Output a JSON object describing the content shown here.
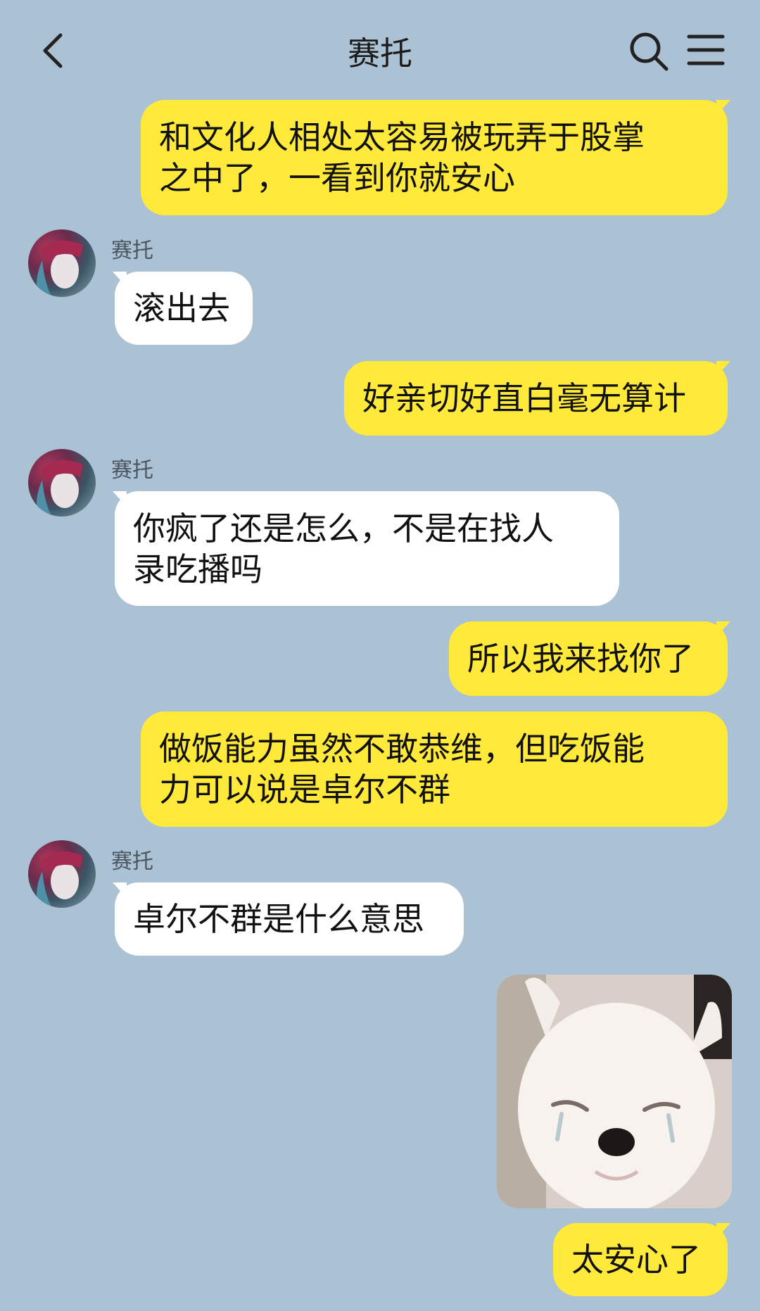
{
  "header": {
    "title": "赛托",
    "back_icon": "chevron-left-icon",
    "search_icon": "search-icon",
    "menu_icon": "menu-icon"
  },
  "colors": {
    "background": "#abc1d4",
    "outgoing_bubble": "#ffe93a",
    "incoming_bubble": "#ffffff"
  },
  "messages": [
    {
      "direction": "out",
      "text": "和文化人相处太容易被玩弄于股掌\n之中了，一看到你就安心"
    },
    {
      "direction": "in",
      "sender": "赛托",
      "text": "滚出去"
    },
    {
      "direction": "out",
      "text": "好亲切好直白毫无算计"
    },
    {
      "direction": "in",
      "sender": "赛托",
      "text": "你疯了还是怎么，不是在找人\n录吃播吗"
    },
    {
      "direction": "out",
      "text": "所以我来找你了"
    },
    {
      "direction": "out",
      "text": "做饭能力虽然不敢恭维，但吃饭能\n力可以说是卓尔不群"
    },
    {
      "direction": "in",
      "sender": "赛托",
      "text": "卓尔不群是什么意思"
    },
    {
      "direction": "out",
      "type": "sticker",
      "description": "crying-puppy-sticker"
    },
    {
      "direction": "out",
      "text": "太安心了"
    }
  ]
}
